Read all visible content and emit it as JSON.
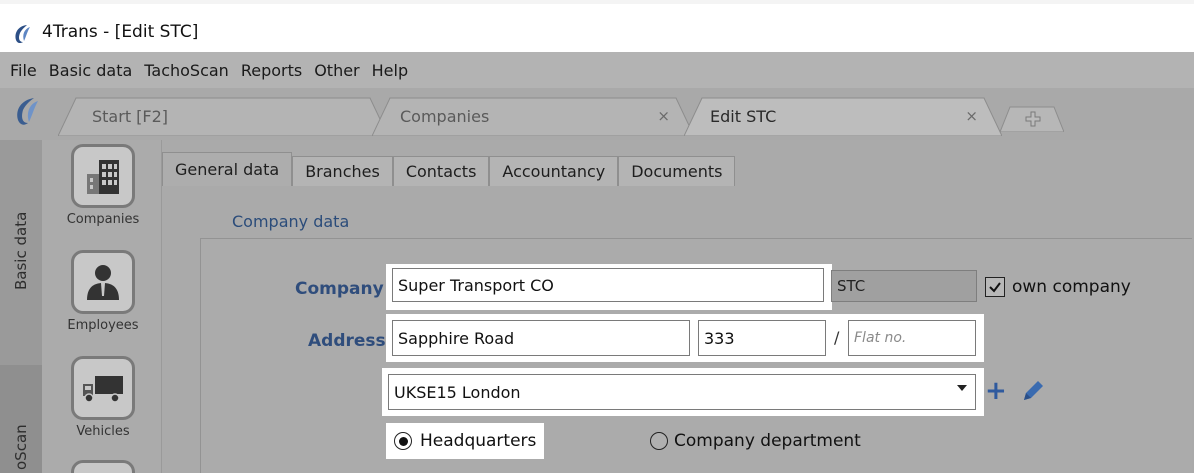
{
  "window": {
    "title": "4Trans - [Edit STC]"
  },
  "menu": {
    "items": [
      "File",
      "Basic data",
      "TachoScan",
      "Reports",
      "Other",
      "Help"
    ]
  },
  "tabs": {
    "start": "Start [F2]",
    "companies": "Companies",
    "edit": "Edit STC",
    "close_symbol": "×"
  },
  "sidebar": {
    "sections": [
      "Basic data",
      "oScan"
    ],
    "buttons": [
      "Companies",
      "Employees",
      "Vehicles"
    ]
  },
  "subtabs": [
    "General data",
    "Branches",
    "Contacts",
    "Accountancy",
    "Documents"
  ],
  "form": {
    "section_title": "Company data",
    "company_label": "Company",
    "company_value": "Super Transport CO",
    "code_value": "STC",
    "own_company_label": "own company",
    "own_company_checked": true,
    "address_label": "Address",
    "street_value": "Sapphire Road",
    "number_value": "333",
    "slash": "/",
    "flat_placeholder": "Flat no.",
    "city_value": "UKSE15 London",
    "radio_headquarters": "Headquarters",
    "radio_department": "Company department",
    "selected_radio": "Headquarters"
  },
  "colors": {
    "accent": "#2f5a9e",
    "label": "#2f4d7c",
    "dim": "#aaaaaa"
  }
}
